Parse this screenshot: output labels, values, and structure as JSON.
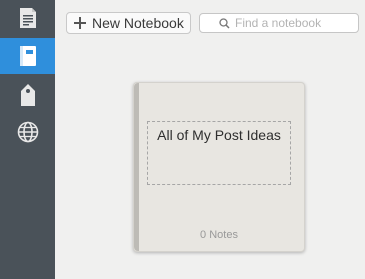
{
  "sidebar": {
    "items": [
      {
        "icon": "note-icon",
        "active": false
      },
      {
        "icon": "notebook-icon",
        "active": true
      },
      {
        "icon": "tag-icon",
        "active": false
      },
      {
        "icon": "globe-icon",
        "active": false
      }
    ],
    "accent_color": "#2f8fdc"
  },
  "toolbar": {
    "new_notebook_label": "New Notebook",
    "search_placeholder": "Find a notebook"
  },
  "notebooks": [
    {
      "title": "All of My Post Ideas",
      "count_label": "0 Notes"
    }
  ]
}
